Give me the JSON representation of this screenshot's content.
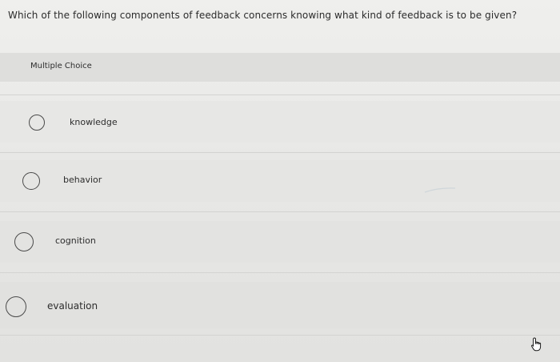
{
  "question": {
    "text": "Which of the following components of feedback concerns knowing what kind of feedback is to be given?"
  },
  "question_type": {
    "label": "Multiple Choice"
  },
  "options": [
    {
      "label": "knowledge",
      "selected": false
    },
    {
      "label": "behavior",
      "selected": false
    },
    {
      "label": "cognition",
      "selected": false
    },
    {
      "label": "evaluation",
      "selected": false
    }
  ],
  "cursor": {
    "icon": "pointer-hand-icon"
  }
}
